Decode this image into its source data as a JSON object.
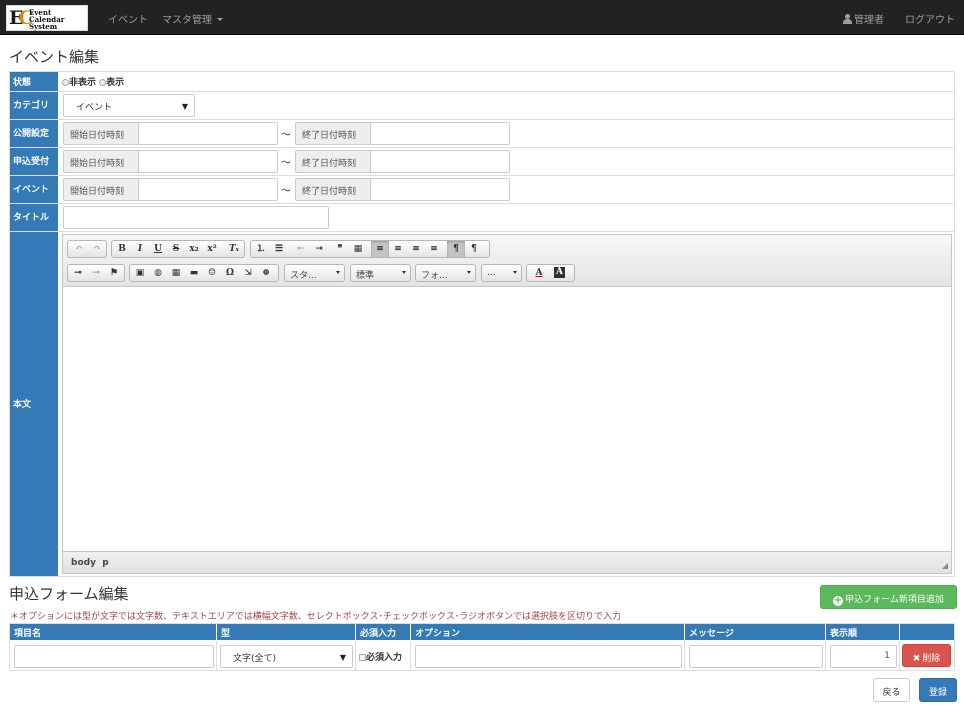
{
  "navbar": {
    "logo": {
      "initials": "EC",
      "line1": "Event",
      "line2": "Calendar",
      "line3": "System"
    },
    "links": [
      {
        "label": "イベント"
      },
      {
        "label": "マスタ管理"
      }
    ],
    "user": "管理者",
    "logout": "ログアウト"
  },
  "page_title": "イベント編集",
  "form": {
    "status": {
      "label": "状態",
      "options": [
        "非表示",
        "表示"
      ]
    },
    "category": {
      "label": "カテゴリ",
      "value": "イベント"
    },
    "publish": {
      "label": "公開設定",
      "start": "開始日付時刻",
      "end": "終了日付時刻",
      "sep": "〜"
    },
    "apply": {
      "label": "申込受付",
      "start": "開始日付時刻",
      "end": "終了日付時刻",
      "sep": "〜"
    },
    "event": {
      "label": "イベント",
      "start": "開始日付時刻",
      "end": "終了日付時刻",
      "sep": "〜"
    },
    "title": {
      "label": "タイトル",
      "value": ""
    },
    "body": {
      "label": "本文"
    }
  },
  "editor": {
    "toolbar_row1": [
      {
        "icon": "undo-icon",
        "glyph": "↶",
        "enabled": false
      },
      {
        "icon": "redo-icon",
        "glyph": "↷",
        "enabled": false
      },
      {
        "icon": "bold-icon",
        "glyph": "B"
      },
      {
        "icon": "italic-icon",
        "glyph": "I"
      },
      {
        "icon": "underline-icon",
        "glyph": "U"
      },
      {
        "icon": "strikethrough-icon",
        "glyph": "S"
      },
      {
        "icon": "subscript-icon",
        "glyph": "x₂"
      },
      {
        "icon": "superscript-icon",
        "glyph": "x²"
      },
      {
        "icon": "remove-format-icon",
        "glyph": "Tₓ"
      },
      {
        "icon": "numbered-list-icon",
        "glyph": "⒈"
      },
      {
        "icon": "bulleted-list-icon",
        "glyph": "☰"
      },
      {
        "icon": "outdent-icon",
        "glyph": "⇤",
        "enabled": false
      },
      {
        "icon": "indent-icon",
        "glyph": "⇥"
      },
      {
        "icon": "blockquote-icon",
        "glyph": "❞"
      },
      {
        "icon": "div-container-icon",
        "glyph": "▦"
      },
      {
        "icon": "align-left-icon",
        "glyph": "≡",
        "active": true
      },
      {
        "icon": "align-center-icon",
        "glyph": "≡"
      },
      {
        "icon": "align-right-icon",
        "glyph": "≡"
      },
      {
        "icon": "align-justify-icon",
        "glyph": "≡"
      },
      {
        "icon": "ltr-icon",
        "glyph": "¶",
        "active": true
      },
      {
        "icon": "rtl-icon",
        "glyph": "¶"
      }
    ],
    "toolbar_row2": [
      {
        "icon": "link-icon",
        "glyph": "⊸"
      },
      {
        "icon": "unlink-icon",
        "glyph": "⊸",
        "enabled": false
      },
      {
        "icon": "anchor-icon",
        "glyph": "⚑"
      },
      {
        "icon": "image-icon",
        "glyph": "▣"
      },
      {
        "icon": "flash-icon",
        "glyph": "◍"
      },
      {
        "icon": "table-icon",
        "glyph": "▦"
      },
      {
        "icon": "horizontal-rule-icon",
        "glyph": "▬"
      },
      {
        "icon": "smiley-icon",
        "glyph": "☺"
      },
      {
        "icon": "special-char-icon",
        "glyph": "Ω"
      },
      {
        "icon": "page-break-icon",
        "glyph": "⇲"
      },
      {
        "icon": "iframe-icon",
        "glyph": "⊕"
      }
    ],
    "combos": [
      "スタ...",
      "標準",
      "フォ...",
      "..."
    ],
    "text_color_label": "A",
    "bg_color_label": "A",
    "path": [
      "body",
      "p"
    ]
  },
  "form_editor": {
    "title": "申込フォーム編集",
    "add_button": "申込フォーム新項目追加",
    "note": "＊オプションには型が文字では文字数、テキストエリアでは横幅文字数、セレクトボックス･チェックボックス･ラジオボタンでは選択肢を区切りで入力",
    "headers": [
      "項目名",
      "型",
      "必須入力",
      "オプション",
      "メッセージ",
      "表示順"
    ],
    "row": {
      "name": "",
      "type": "文字(全て)",
      "required_label": "必須入力",
      "option": "",
      "message": "",
      "order": "1",
      "delete": "削除"
    }
  },
  "actions": {
    "back": "戻る",
    "save": "登録"
  },
  "colors": {
    "navbar": "#222222",
    "header_blue": "#337ab7",
    "add_green": "#5cb85c",
    "delete_red": "#d9534f",
    "note_red": "#a94442"
  }
}
